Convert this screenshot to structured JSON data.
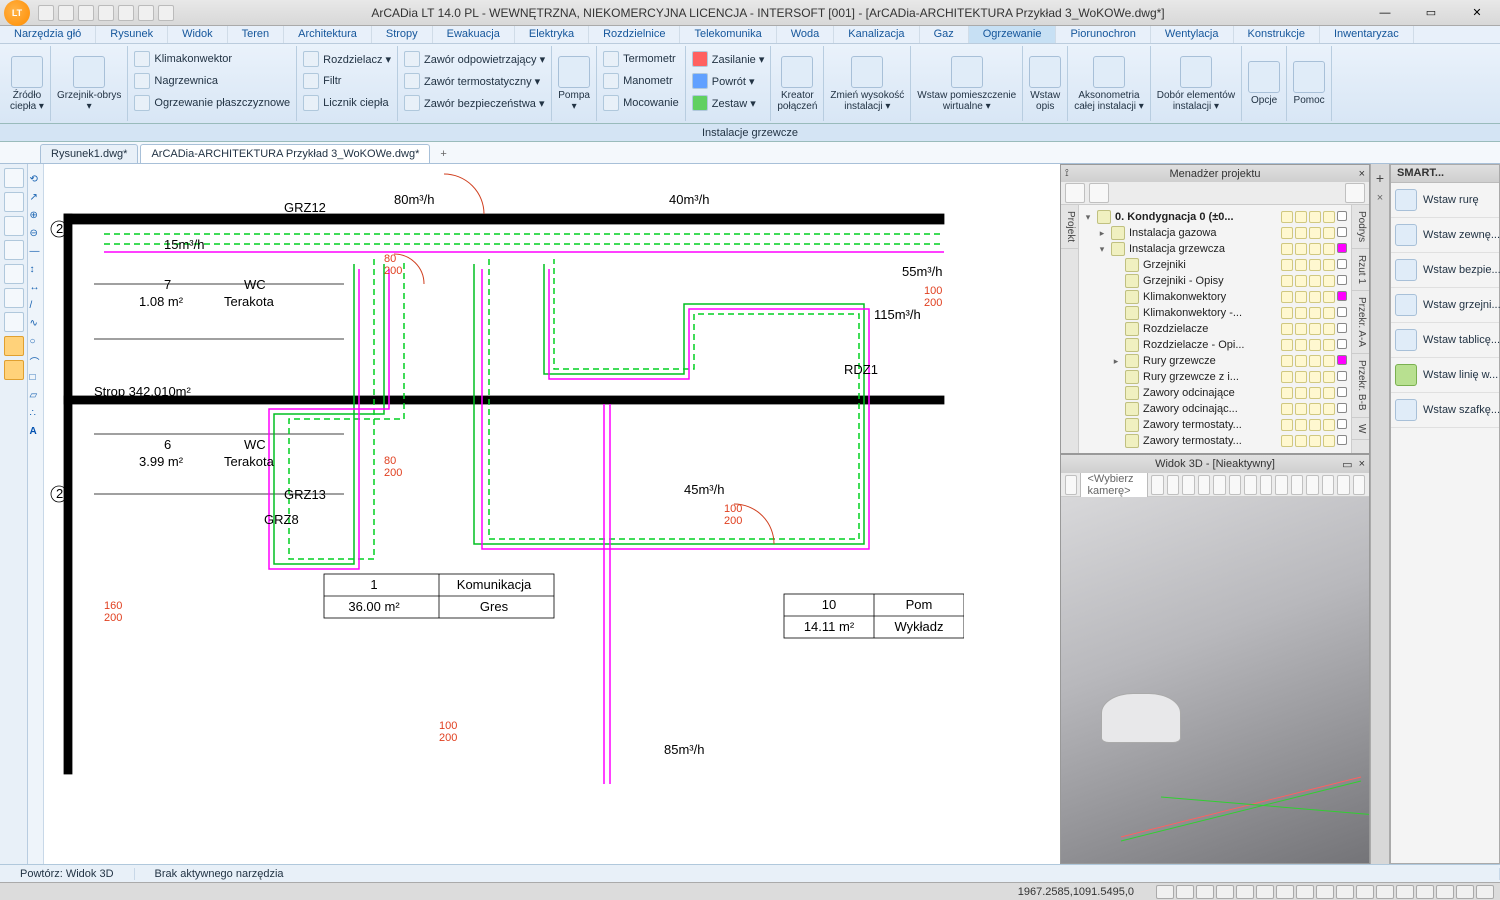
{
  "titlebar": {
    "title": "ArCADia LT 14.0 PL - WEWNĘTRZNA, NIEKOMERCYJNA LICENCJA - INTERSOFT [001] - [ArCADia-ARCHITEKTURA Przykład 3_WoKOWe.dwg*]"
  },
  "menubar": {
    "tabs": [
      "Narzędzia głó",
      "Rysunek",
      "Widok",
      "Teren",
      "Architektura",
      "Stropy",
      "Ewakuacja",
      "Elektryka",
      "Rozdzielnice",
      "Telekomunika",
      "Woda",
      "Kanalizacja",
      "Gaz",
      "Ogrzewanie",
      "Piorunochron",
      "Wentylacja",
      "Konstrukcje",
      "Inwentaryzac"
    ],
    "active": 13
  },
  "ribbon": {
    "big1": {
      "label": "Źródło\nciepła ▾"
    },
    "big2": {
      "label": "Grzejnik-obrys\n▾"
    },
    "col1": [
      "Klimakonwektor",
      "Nagrzewnica",
      "Ogrzewanie płaszczyznowe"
    ],
    "col2": [
      "Rozdzielacz ▾",
      "Filtr",
      "Licznik ciepła"
    ],
    "col3": [
      "Zawór odpowietrzający ▾",
      "Zawór termostatyczny ▾",
      "Zawór bezpieczeństwa ▾"
    ],
    "big3": {
      "label": "Pompa\n▾"
    },
    "col4": [
      "Termometr",
      "Manometr",
      "Mocowanie"
    ],
    "col5": [
      "Zasilanie ▾",
      "Powrót ▾",
      "Zestaw ▾"
    ],
    "big4": {
      "label": "Kreator\npołączeń"
    },
    "big5": {
      "label": "Zmień wysokość\ninstalacji ▾"
    },
    "big6": {
      "label": "Wstaw pomieszczenie\nwirtualne ▾"
    },
    "big7": {
      "label": "Wstaw\nopis"
    },
    "big8": {
      "label": "Aksonometria\ncałej instalacji ▾"
    },
    "big9": {
      "label": "Dobór elementów\ninstalacji ▾"
    },
    "big10": {
      "label": "Opcje"
    },
    "big11": {
      "label": "Pomoc"
    },
    "caption": "Instalacje grzewcze"
  },
  "doctabs": {
    "tabs": [
      "Rysunek1.dwg*",
      "ArCADia-ARCHITEKTURA Przykład 3_WoKOWe.dwg*"
    ],
    "active": 1
  },
  "pm": {
    "title": "Menadżer projektu",
    "sidetabs_l": [
      "Projekt"
    ],
    "sidetabs_r": [
      "Podrys",
      "Rzut 1",
      "Przekr. A-A",
      "Przekr. B-B",
      "W"
    ],
    "tree": [
      {
        "indent": 0,
        "exp": "▾",
        "label": "0. Kondygnacja 0 (±0...",
        "bold": true,
        "sw": ""
      },
      {
        "indent": 1,
        "exp": "▸",
        "label": "Instalacja gazowa",
        "sw": ""
      },
      {
        "indent": 1,
        "exp": "▾",
        "label": "Instalacja grzewcza",
        "sw": "#ff00ff"
      },
      {
        "indent": 2,
        "exp": "",
        "label": "Grzejniki",
        "sw": ""
      },
      {
        "indent": 2,
        "exp": "",
        "label": "Grzejniki - Opisy",
        "sw": ""
      },
      {
        "indent": 2,
        "exp": "",
        "label": "Klimakonwektory",
        "sw": "#ff00ff"
      },
      {
        "indent": 2,
        "exp": "",
        "label": "Klimakonwektory -...",
        "sw": ""
      },
      {
        "indent": 2,
        "exp": "",
        "label": "Rozdzielacze",
        "sw": ""
      },
      {
        "indent": 2,
        "exp": "",
        "label": "Rozdzielacze - Opi...",
        "sw": ""
      },
      {
        "indent": 2,
        "exp": "▸",
        "label": "Rury grzewcze",
        "sw": "#ff00ff"
      },
      {
        "indent": 2,
        "exp": "",
        "label": "Rury grzewcze z i...",
        "sw": ""
      },
      {
        "indent": 2,
        "exp": "",
        "label": "Zawory odcinające",
        "sw": ""
      },
      {
        "indent": 2,
        "exp": "",
        "label": "Zawory odcinając...",
        "sw": ""
      },
      {
        "indent": 2,
        "exp": "",
        "label": "Zawory termostaty...",
        "sw": ""
      },
      {
        "indent": 2,
        "exp": "",
        "label": "Zawory termostaty...",
        "sw": ""
      }
    ]
  },
  "smart": {
    "title": "SMART...",
    "items": [
      "Wstaw rurę",
      "Wstaw zewnę...",
      "Wstaw bezpie...",
      "Wstaw grzejni...",
      "Wstaw tablicę...",
      "Wstaw linię w...",
      "Wstaw szafkę..."
    ]
  },
  "view3d": {
    "title": "Widok 3D - [Nieaktywny]",
    "camera": "<Wybierz kamerę>"
  },
  "statusbar": {
    "repeat": "Powtórz: Widok 3D",
    "tool": "Brak aktywnego narzędzia"
  },
  "statusbar2": {
    "coord": "1967.2585,1091.5495,0"
  },
  "canvas": {
    "labels": {
      "grz12": "GRZ12",
      "grz13": "GRZ13",
      "grz8": "GRZ8",
      "air80": "80m³/h",
      "air40": "40m³/h",
      "air55": "55m³/h",
      "air45": "45m³/h",
      "air85": "85m³/h",
      "air15": "15m³/h",
      "r100": "100",
      "r200": "200",
      "r80": "80",
      "r160": "160",
      "r115": "115m³/h",
      "room7n": "7",
      "room7l": "WC",
      "room7a": "1.08 m²",
      "room7m": "Terakota",
      "room6n": "6",
      "room6l": "WC",
      "room6a": "3.99 m²",
      "room6m": "Terakota",
      "room1n": "1",
      "room1l": "Komunikacja",
      "room1a": "36.00 m²",
      "room1m": "Gres",
      "room10n": "10",
      "room10l": "Pom",
      "room10a": "14.11 m²",
      "room10m": "Wykładz",
      "rdz1": "RDZ1",
      "strop": "Strop 342.010m²"
    }
  }
}
